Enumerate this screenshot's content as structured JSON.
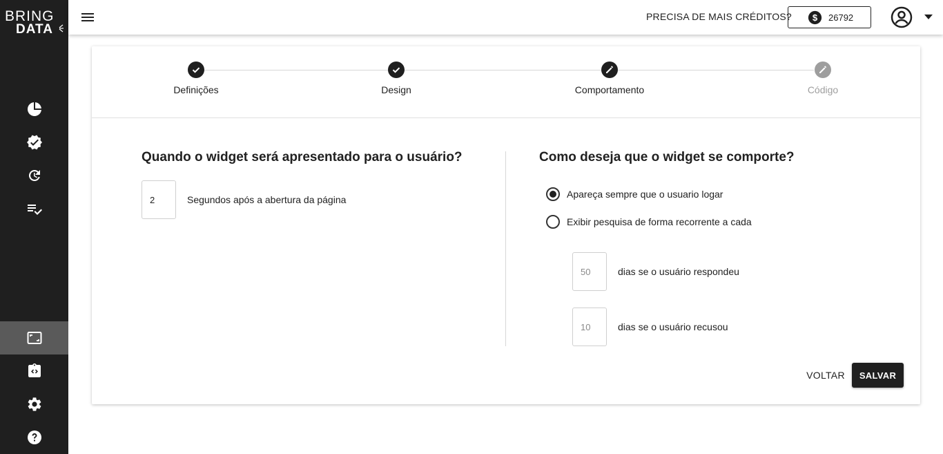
{
  "brand": {
    "line1": "BRING",
    "line2": "DATA"
  },
  "sidebar": {
    "items": [
      {
        "icon": "pie-chart-icon"
      },
      {
        "icon": "verified-badge-icon"
      },
      {
        "icon": "history-icon"
      },
      {
        "icon": "checklist-icon"
      },
      {
        "icon": "widget-frame-icon",
        "active": true
      },
      {
        "icon": "code-clipboard-icon"
      },
      {
        "icon": "gear-icon"
      },
      {
        "icon": "help-icon"
      }
    ]
  },
  "header": {
    "credits_prompt": "PRECISA DE MAIS CRÉDITOS?",
    "credits_value": "26792"
  },
  "stepper": {
    "steps": [
      {
        "label": "Definições",
        "state": "done"
      },
      {
        "label": "Design",
        "state": "done"
      },
      {
        "label": "Comportamento",
        "state": "editing"
      },
      {
        "label": "Código",
        "state": "disabled"
      }
    ]
  },
  "left": {
    "title": "Quando o widget será apresentado para o usuário?",
    "seconds_value": "2",
    "seconds_label": "Segundos após a abertura da página"
  },
  "right": {
    "title": "Como deseja que o widget se comporte?",
    "option_always": "Apareça sempre que o usuario logar",
    "option_recurrent": "Exibir pesquisa de forma recorrente a cada",
    "selected": "always",
    "days_answered_value": "50",
    "days_answered_label": "dias se o usuário respondeu",
    "days_refused_value": "10",
    "days_refused_label": "dias se o usuário recusou"
  },
  "actions": {
    "back_label": "VOLTAR",
    "save_label": "SALVAR"
  },
  "colors": {
    "sidebar_bg": "#1f1f1f",
    "active_nav": "#5a5a5a",
    "primary": "#1f1f1f",
    "disabled": "#9e9e9e"
  }
}
